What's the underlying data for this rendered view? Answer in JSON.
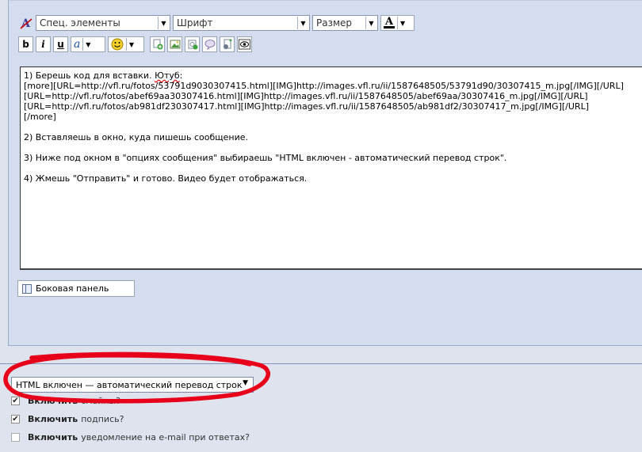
{
  "toolbar": {
    "special_elements": "Спец. элементы",
    "font": "Шрифт",
    "size": "Размер",
    "font_color_letter": "A",
    "bold": "b",
    "italic": "i",
    "underline": "u",
    "highlight_letter": "a"
  },
  "editor": {
    "line1": "1) Берешь код для вставки. ",
    "line1_link": "Ютуб",
    "line1_end": ":",
    "line2": "[more][URL=http://vfl.ru/fotos/53791d9030307415.html][IMG]http://images.vfl.ru/ii/1587648505/53791d90/30307415_m.jpg[/IMG][/URL]",
    "line3": "[URL=http://vfl.ru/fotos/abef69aa30307416.html][IMG]http://images.vfl.ru/ii/1587648505/abef69aa/30307416_m.jpg[/IMG][/URL]",
    "line4": "[URL=http://vfl.ru/fotos/ab981df230307417.html][IMG]http://images.vfl.ru/ii/1587648505/ab981df2/30307417_m.jpg[/IMG][/URL]",
    "line5": "[/more]",
    "step2": "2) Вставляешь в окно, куда пишешь сообщение.",
    "step3": "3) Ниже под окном в \"опциях сообщения\" выбираешь \"HTML включен - автоматический перевод строк\".",
    "step4": "4) Жмешь \"Отправить\" и готово. Видео будет отображаться."
  },
  "sidebar_button": "Боковая панель",
  "options": {
    "html_mode": "HTML включен — автоматический перевод строк",
    "opt1_bold": "Включить",
    "opt1_rest": "смайлы?",
    "opt1_checked": true,
    "opt2_bold": "Включить",
    "opt2_rest": "подпись?",
    "opt2_checked": true,
    "opt3_bold": "Включить",
    "opt3_rest": "уведомление на e-mail при ответах?",
    "opt3_checked": false
  },
  "colors": {
    "annotation": "#e8001a"
  }
}
